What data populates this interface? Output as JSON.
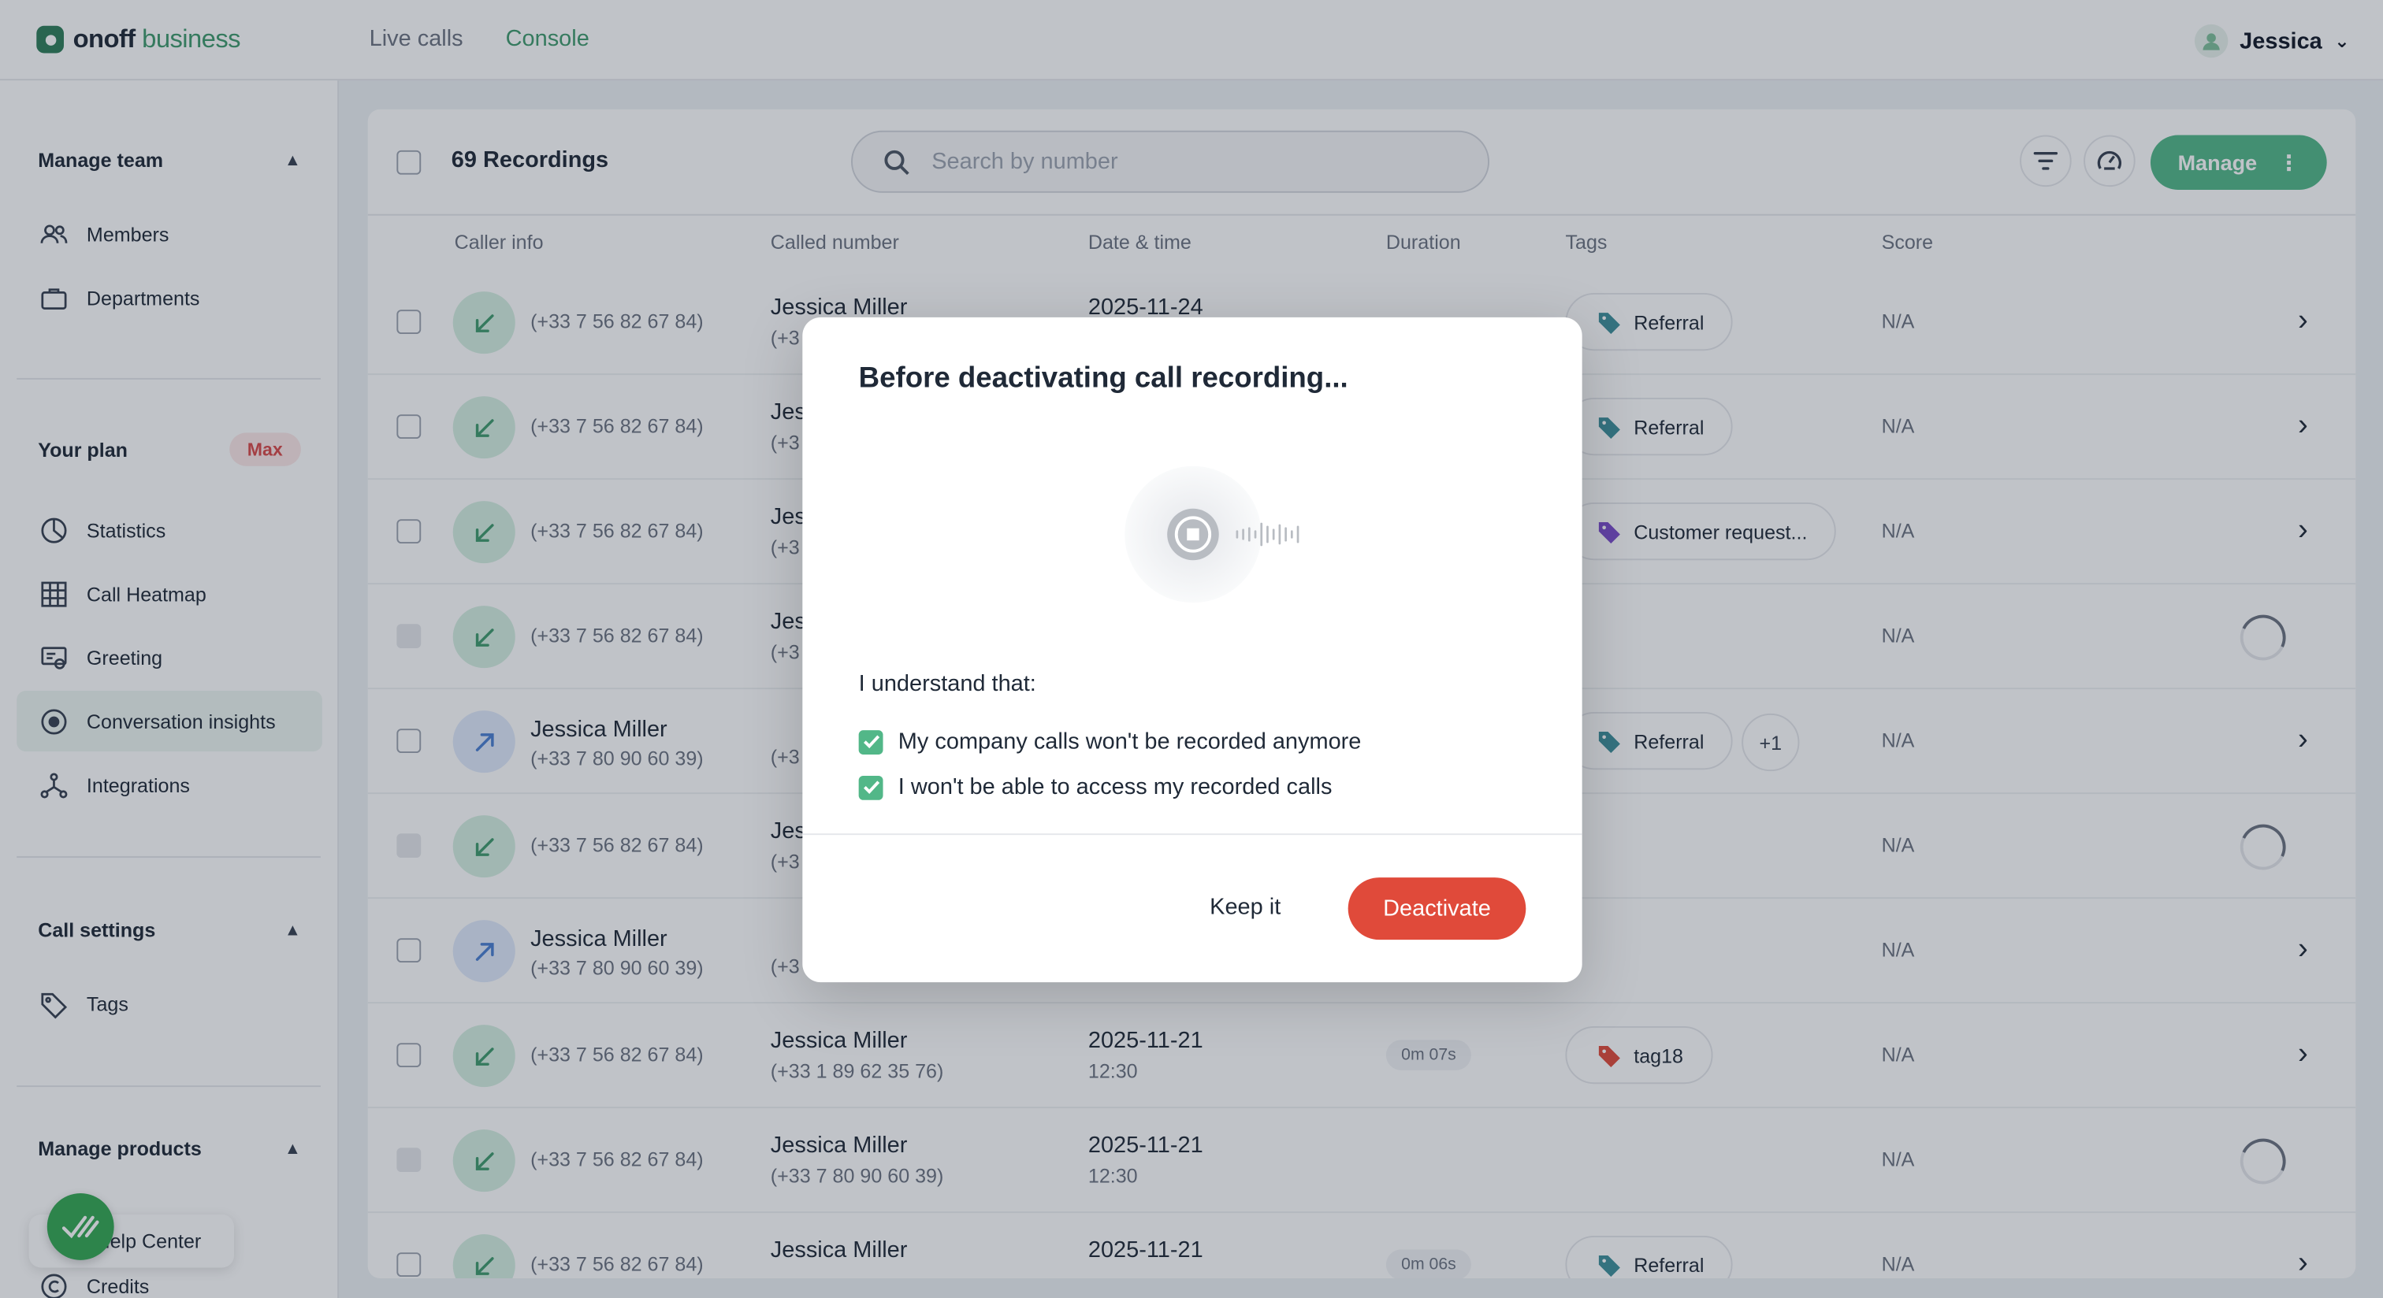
{
  "header": {
    "brand_name": "onoff",
    "brand_suffix": "business",
    "tabs": [
      {
        "label": "Live calls",
        "active": false
      },
      {
        "label": "Console",
        "active": true
      }
    ],
    "user_name": "Jessica"
  },
  "sidebar": {
    "manage_team": {
      "title": "Manage team",
      "items": [
        {
          "label": "Members",
          "icon": "members-icon"
        },
        {
          "label": "Departments",
          "icon": "briefcase-icon"
        }
      ]
    },
    "plan": {
      "title": "Your plan",
      "badge": "Max",
      "items": [
        {
          "label": "Statistics",
          "icon": "pie-chart-icon"
        },
        {
          "label": "Call Heatmap",
          "icon": "grid-icon"
        },
        {
          "label": "Greeting",
          "icon": "greeting-icon"
        },
        {
          "label": "Conversation insights",
          "icon": "insights-icon",
          "active": true
        },
        {
          "label": "Integrations",
          "icon": "integrations-icon"
        }
      ]
    },
    "call_settings": {
      "title": "Call settings",
      "items": [
        {
          "label": "Tags",
          "icon": "tag-icon"
        }
      ]
    },
    "manage_products": {
      "title": "Manage products",
      "items": [
        {
          "label": "Help Center",
          "icon": "help-icon"
        },
        {
          "label": "Credits",
          "icon": "credits-icon"
        }
      ]
    }
  },
  "recordings": {
    "count_label": "69 Recordings",
    "search_placeholder": "Search by number",
    "manage_label": "Manage",
    "columns": [
      "Caller info",
      "Called number",
      "Date & time",
      "Duration",
      "Tags",
      "Score"
    ],
    "rows": [
      {
        "direction": "in",
        "caller_name": "",
        "caller_number": "(+33 7 56 82 67 84)",
        "called_name": "Jessica Miller",
        "called_number": "(+3",
        "date": "2025-11-24",
        "time": "",
        "duration": "",
        "tags": [
          "Referral"
        ],
        "tag_colors": [
          "#3e8f9a"
        ],
        "more": "",
        "score": "N/A",
        "status": "arrow",
        "disabled": false
      },
      {
        "direction": "in",
        "caller_name": "",
        "caller_number": "(+33 7 56 82 67 84)",
        "called_name": "Jes",
        "called_number": "(+3",
        "date": "",
        "time": "",
        "duration": "",
        "tags": [
          "Referral"
        ],
        "tag_colors": [
          "#3e8f9a"
        ],
        "more": "",
        "score": "N/A",
        "status": "arrow",
        "disabled": false
      },
      {
        "direction": "in",
        "caller_name": "",
        "caller_number": "(+33 7 56 82 67 84)",
        "called_name": "Jes",
        "called_number": "(+3",
        "date": "",
        "time": "",
        "duration": "",
        "tags": [
          "Customer request..."
        ],
        "tag_colors": [
          "#7c4dcc"
        ],
        "more": "",
        "score": "N/A",
        "status": "arrow",
        "disabled": false
      },
      {
        "direction": "in",
        "caller_name": "",
        "caller_number": "(+33 7 56 82 67 84)",
        "called_name": "Jes",
        "called_number": "(+3",
        "date": "",
        "time": "",
        "duration": "",
        "tags": [],
        "tag_colors": [],
        "more": "",
        "score": "N/A",
        "status": "loading",
        "disabled": true
      },
      {
        "direction": "out",
        "caller_name": "Jessica Miller",
        "caller_number": "(+33 7 80 90 60 39)",
        "called_name": "",
        "called_number": "(+3",
        "date": "",
        "time": "",
        "duration": "",
        "tags": [
          "Referral"
        ],
        "tag_colors": [
          "#3e8f9a"
        ],
        "more": "+1",
        "score": "N/A",
        "status": "arrow",
        "disabled": false
      },
      {
        "direction": "in",
        "caller_name": "",
        "caller_number": "(+33 7 56 82 67 84)",
        "called_name": "Jes",
        "called_number": "(+3",
        "date": "",
        "time": "",
        "duration": "",
        "tags": [],
        "tag_colors": [],
        "more": "",
        "score": "N/A",
        "status": "loading",
        "disabled": true
      },
      {
        "direction": "out",
        "caller_name": "Jessica Miller",
        "caller_number": "(+33 7 80 90 60 39)",
        "called_name": "",
        "called_number": "(+3",
        "date": "",
        "time": "",
        "duration": "",
        "tags": [],
        "tag_colors": [],
        "more": "",
        "score": "N/A",
        "status": "arrow",
        "disabled": false
      },
      {
        "direction": "in",
        "caller_name": "",
        "caller_number": "(+33 7 56 82 67 84)",
        "called_name": "Jessica Miller",
        "called_number": "(+33 1 89 62 35 76)",
        "date": "2025-11-21",
        "time": "12:30",
        "duration": "0m 07s",
        "tags": [
          "tag18"
        ],
        "tag_colors": [
          "#e04a3a"
        ],
        "more": "",
        "score": "N/A",
        "status": "arrow",
        "disabled": false
      },
      {
        "direction": "in",
        "caller_name": "",
        "caller_number": "(+33 7 56 82 67 84)",
        "called_name": "Jessica Miller",
        "called_number": "(+33 7 80 90 60 39)",
        "date": "2025-11-21",
        "time": "12:30",
        "duration": "",
        "tags": [],
        "tag_colors": [],
        "more": "",
        "score": "N/A",
        "status": "loading",
        "disabled": true
      },
      {
        "direction": "in",
        "caller_name": "",
        "caller_number": "(+33 7 56 82 67 84)",
        "called_name": "Jessica Miller",
        "called_number": "",
        "date": "2025-11-21",
        "time": "",
        "duration": "0m 06s",
        "tags": [
          "Referral"
        ],
        "tag_colors": [
          "#3e8f9a"
        ],
        "more": "",
        "score": "N/A",
        "status": "arrow",
        "disabled": false
      }
    ]
  },
  "modal": {
    "title": "Before deactivating call recording...",
    "understand_label": "I understand that:",
    "checks": [
      {
        "label": "My company calls won't be recorded anymore",
        "checked": true
      },
      {
        "label": "I won't be able to access my recorded calls",
        "checked": true
      }
    ],
    "keep_label": "Keep it",
    "deactivate_label": "Deactivate"
  },
  "colors": {
    "accent_green": "#52b788",
    "danger_red": "#e04a3a",
    "plan_badge_red": "#d94848"
  }
}
